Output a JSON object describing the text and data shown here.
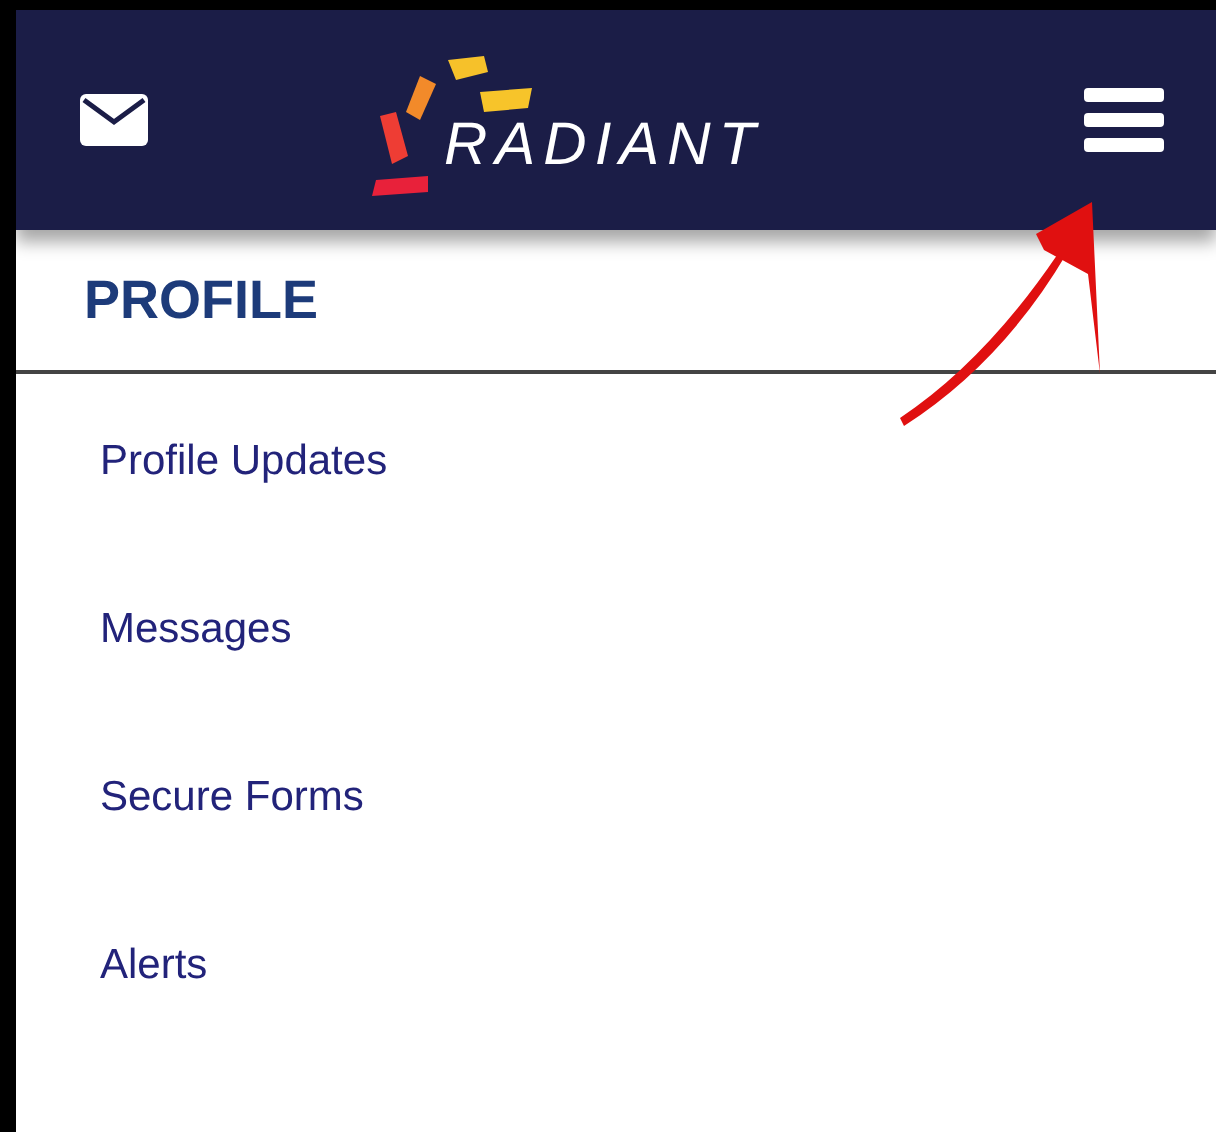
{
  "header": {
    "logo_text": "RADIANT"
  },
  "section": {
    "title": "PROFILE"
  },
  "menu_items": [
    {
      "label": "Profile Updates"
    },
    {
      "label": "Messages"
    },
    {
      "label": "Secure Forms"
    },
    {
      "label": "Alerts"
    }
  ]
}
